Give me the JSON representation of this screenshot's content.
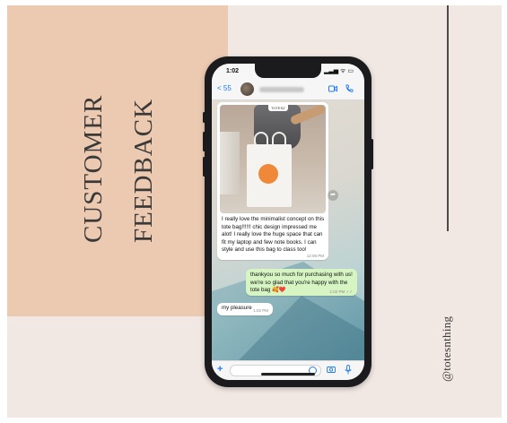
{
  "title": {
    "line1": "CUSTOMER",
    "line2": "FEEDBACK"
  },
  "handle": "@totesnthing",
  "phone": {
    "status_time": "1:02",
    "status_icons": "▂▃▅ ᯤ ▭",
    "back_label": "< 55",
    "photo_tag": "TOTESZ",
    "message_in_1": "I really love the minimalist concept on this tote bag!!!!!! chic design impressed me alot! I really love the huge space that can fit my laptop and few note books. I can style and use this bag to class too!",
    "message_in_1_time": "12:06 PM",
    "message_out_1": "thankyou so much for purchasing with us! we're so glad that you're happy with the tote bag 🥰❤️",
    "message_out_1_time": "1:02 PM ✓✓",
    "message_in_2": "my pleasure",
    "message_in_2_time": "1:02 PM",
    "composer_plus": "+"
  },
  "colors": {
    "background": "#f1e7e3",
    "peach": "#eccab2",
    "accent_blue": "#1e7cf0",
    "bubble_out": "#d6f5c3"
  }
}
